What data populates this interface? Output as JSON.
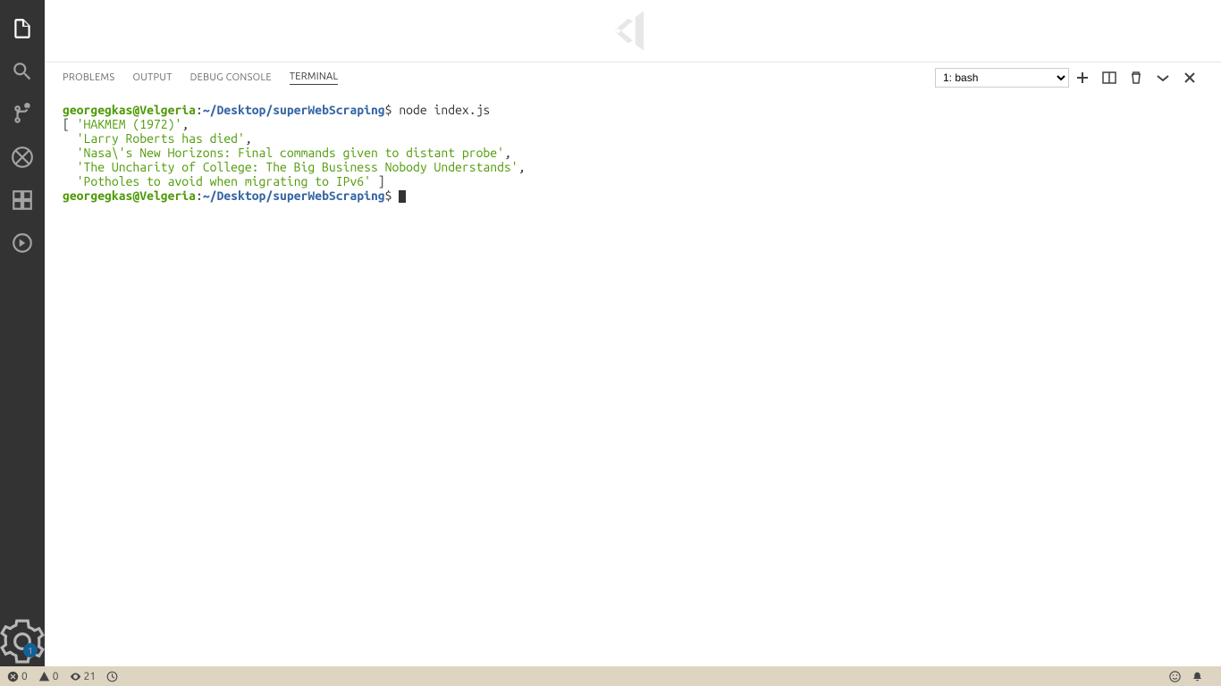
{
  "activity_bar": {
    "items": [
      {
        "name": "explorer"
      },
      {
        "name": "search"
      },
      {
        "name": "source-control"
      },
      {
        "name": "debug"
      },
      {
        "name": "extensions"
      },
      {
        "name": "live-share"
      }
    ],
    "settings_badge": "1"
  },
  "panel": {
    "tabs": [
      {
        "label": "PROBLEMS"
      },
      {
        "label": "OUTPUT"
      },
      {
        "label": "DEBUG CONSOLE"
      },
      {
        "label": "TERMINAL"
      }
    ],
    "terminal_select": "1: bash"
  },
  "terminal": {
    "prompt_user": "georgegkas@Velgeria",
    "prompt_sep": ":",
    "prompt_path": "~/Desktop/superWebScraping",
    "prompt_char": "$",
    "command": "node index.js",
    "output_open": "[ ",
    "output_items": [
      "'HAKMEM (1972)'",
      "'Larry Roberts has died'",
      "'Nasa\\'s New Horizons: Final commands given to distant probe'",
      "'The Uncharity of College: The Big Business Nobody Understands'",
      "'Potholes to avoid when migrating to IPv6'"
    ],
    "output_close": " ]"
  },
  "status_bar": {
    "errors": "0",
    "warnings": "0",
    "eye": "21"
  }
}
